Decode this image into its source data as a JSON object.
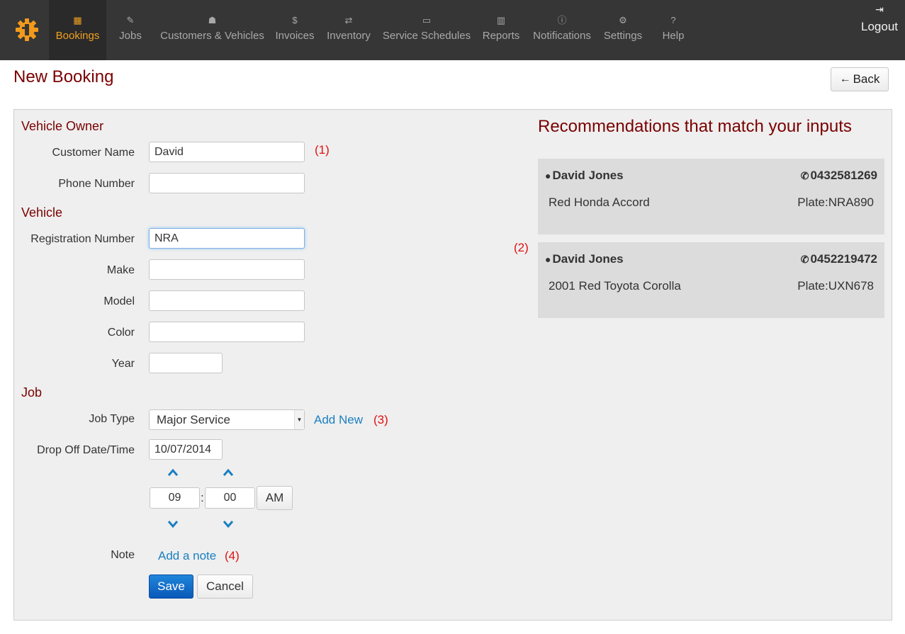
{
  "nav": {
    "items": [
      {
        "label": "Bookings",
        "icon": "calendar-icon",
        "glyph": "▦",
        "active": true
      },
      {
        "label": "Jobs",
        "icon": "wrench-icon",
        "glyph": "✎"
      },
      {
        "label": "Customers & Vehicles",
        "icon": "users-icon",
        "glyph": "☗"
      },
      {
        "label": "Invoices",
        "icon": "dollar-icon",
        "glyph": "$"
      },
      {
        "label": "Inventory",
        "icon": "exchange-icon",
        "glyph": "⇄"
      },
      {
        "label": "Service Schedules",
        "icon": "calendar-empty-icon",
        "glyph": "▭"
      },
      {
        "label": "Reports",
        "icon": "bar-chart-icon",
        "glyph": "▥"
      },
      {
        "label": "Notifications",
        "icon": "info-icon",
        "glyph": "ⓘ"
      },
      {
        "label": "Settings",
        "icon": "cogs-icon",
        "glyph": "⚙"
      },
      {
        "label": "Help",
        "icon": "question-icon",
        "glyph": "?"
      }
    ],
    "logout": {
      "label": "Logout",
      "icon": "sign-out-icon",
      "glyph": "⇥"
    }
  },
  "header": {
    "title": "New Booking",
    "back_label": "Back",
    "back_glyph": "←"
  },
  "form": {
    "vehicle_owner_heading": "Vehicle Owner",
    "customer_name": {
      "label": "Customer Name",
      "value": "David"
    },
    "phone_number": {
      "label": "Phone Number",
      "value": ""
    },
    "vehicle_heading": "Vehicle",
    "registration": {
      "label": "Registration Number",
      "value": "NRA"
    },
    "make": {
      "label": "Make",
      "value": ""
    },
    "model": {
      "label": "Model",
      "value": ""
    },
    "color": {
      "label": "Color",
      "value": ""
    },
    "year": {
      "label": "Year",
      "value": ""
    },
    "job_heading": "Job",
    "job_type": {
      "label": "Job Type",
      "value": "Major Service",
      "add_new": "Add New"
    },
    "dropoff": {
      "label": "Drop Off Date/Time",
      "date": "10/07/2014",
      "hour": "09",
      "minute": "00",
      "separator": ":",
      "ampm": "AM"
    },
    "note": {
      "label": "Note",
      "link": "Add a note"
    },
    "save_label": "Save",
    "cancel_label": "Cancel"
  },
  "annotations": {
    "a1": "(1)",
    "a2": "(2)",
    "a3": "(3)",
    "a4": "(4)"
  },
  "recommendations": {
    "title": "Recommendations that match your inputs",
    "items": [
      {
        "name": "David Jones",
        "phone": "0432581269",
        "vehicle": "Red Honda Accord",
        "plate": "Plate:NRA890"
      },
      {
        "name": "David Jones",
        "phone": "0452219472",
        "vehicle": "2001 Red Toyota Corolla",
        "plate": "Plate:UXN678"
      }
    ]
  },
  "colors": {
    "accent": "#f0a020",
    "heading": "#7a0000",
    "link": "#1a7fc0",
    "annotation": "#e01010",
    "navbar": "#363636"
  }
}
